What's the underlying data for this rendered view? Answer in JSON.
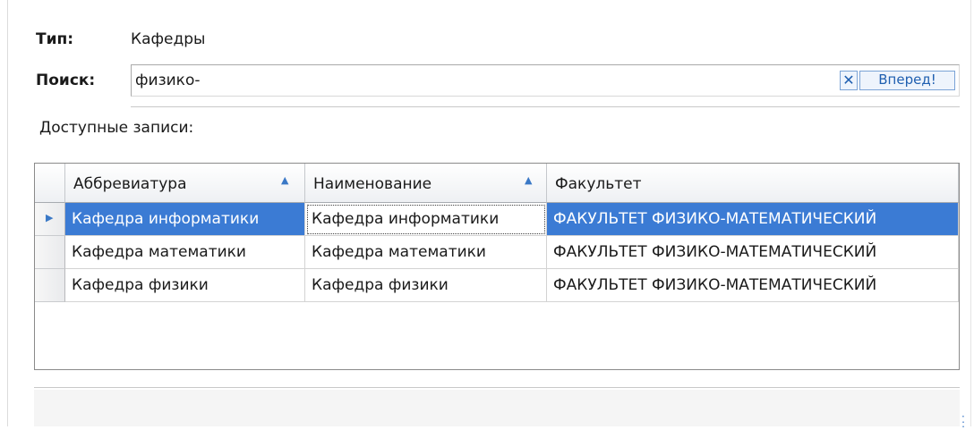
{
  "type_row": {
    "label": "Тип:",
    "value": "Кафедры"
  },
  "search_row": {
    "label": "Поиск:",
    "input_value": "физико-",
    "clear_glyph": "✕",
    "next_button": "Вперед!"
  },
  "available_label": "Доступные записи:",
  "grid": {
    "columns": [
      {
        "label": "Аббревиатура",
        "sort": "ascending"
      },
      {
        "label": "Наименование",
        "sort": "ascending"
      },
      {
        "label": "Факультет",
        "sort": "none"
      }
    ],
    "rows": [
      {
        "abbr": "Кафедра информатики",
        "name": "Кафедра информатики",
        "faculty": "ФАКУЛЬТЕТ ФИЗИКО-МАТЕМАТИЧЕСКИЙ",
        "selected": true
      },
      {
        "abbr": "Кафедра математики",
        "name": "Кафедра математики",
        "faculty": "ФАКУЛЬТЕТ ФИЗИКО-МАТЕМАТИЧЕСКИЙ",
        "selected": false
      },
      {
        "abbr": "Кафедра физики",
        "name": "Кафедра физики",
        "faculty": "ФАКУЛЬТЕТ ФИЗИКО-МАТЕМАТИЧЕСКИЙ",
        "selected": false
      }
    ]
  },
  "colors": {
    "selection": "#3b7bd4",
    "accent": "#3a78c6"
  },
  "icons": {
    "sort": "sort-ascending-icon",
    "row_pointer": "row-pointer-icon",
    "clear": "clear-search-icon",
    "resize": "resize-grip-icon"
  }
}
